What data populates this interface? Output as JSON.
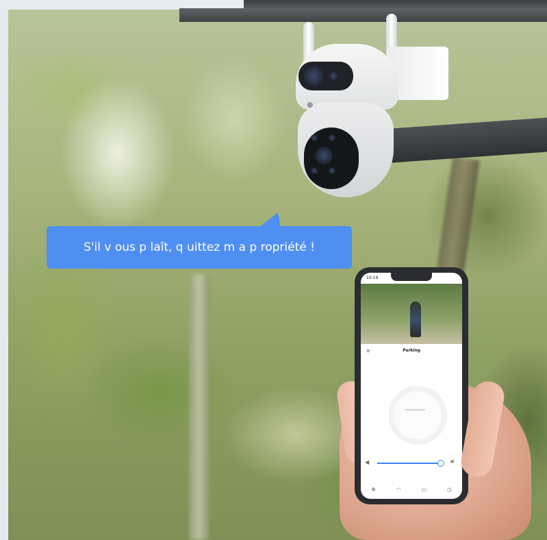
{
  "speech_bubble": {
    "text": "S'il v ous p laît, q uittez m a p ropriété !"
  },
  "camera": {
    "logo_icon": "ezviz-logo-icon"
  },
  "phone": {
    "status_time": "10:19",
    "app_title": "Parking",
    "icons": {
      "menu": "menu-icon",
      "volume": "volume-icon",
      "ptz": "ptz-control-icon",
      "nav": [
        "ptz-icon",
        "talk-icon",
        "record-icon",
        "alarm-icon"
      ]
    }
  },
  "colors": {
    "bubble": "#4f8ff2",
    "bubble_text": "#ffffff",
    "slider": "#3b82f6"
  }
}
